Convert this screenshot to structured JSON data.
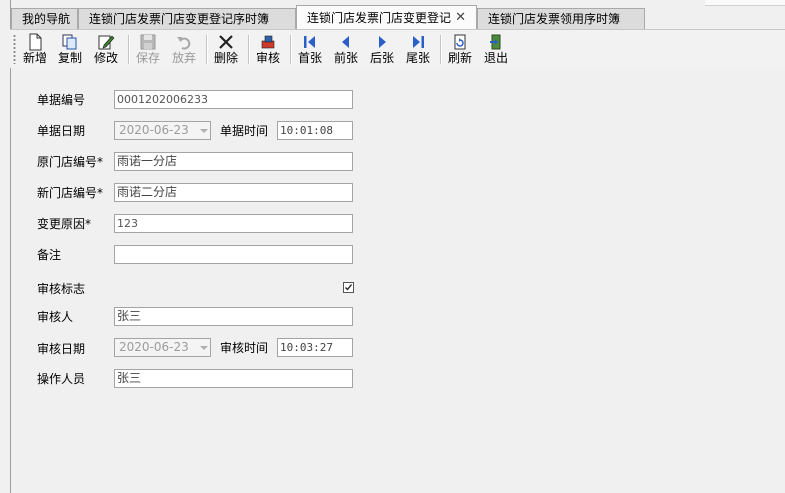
{
  "tabs": [
    {
      "label": "我的导航"
    },
    {
      "label": "连锁门店发票门店变更登记序时簿"
    },
    {
      "label": "连锁门店发票门店变更登记",
      "close": "✕"
    },
    {
      "label": "连锁门店发票领用序时簿"
    }
  ],
  "toolbar": {
    "new": "新增",
    "copy": "复制",
    "edit": "修改",
    "save": "保存",
    "discard": "放弃",
    "delete": "删除",
    "audit": "审核",
    "first": "首张",
    "prev": "前张",
    "next": "后张",
    "last": "尾张",
    "refresh": "刷新",
    "exit": "退出"
  },
  "form": {
    "doc_no_label": "单据编号",
    "doc_no": "0001202006233",
    "doc_date_label": "单据日期",
    "doc_date": "2020-06-23",
    "doc_time_label": "单据时间",
    "doc_time": "10:01:08",
    "orig_store_label": "原门店编号*",
    "orig_store": "雨诺一分店",
    "new_store_label": "新门店编号*",
    "new_store": "雨诺二分店",
    "reason_label": "变更原因*",
    "reason": "123",
    "remark_label": "备注",
    "remark": "",
    "audit_flag_label": "审核标志",
    "audit_flag": true,
    "auditor_label": "审核人",
    "auditor": "张三",
    "audit_date_label": "审核日期",
    "audit_date": "2020-06-23",
    "audit_time_label": "审核时间",
    "audit_time": "10:03:27",
    "operator_label": "操作人员",
    "operator": "张三"
  }
}
